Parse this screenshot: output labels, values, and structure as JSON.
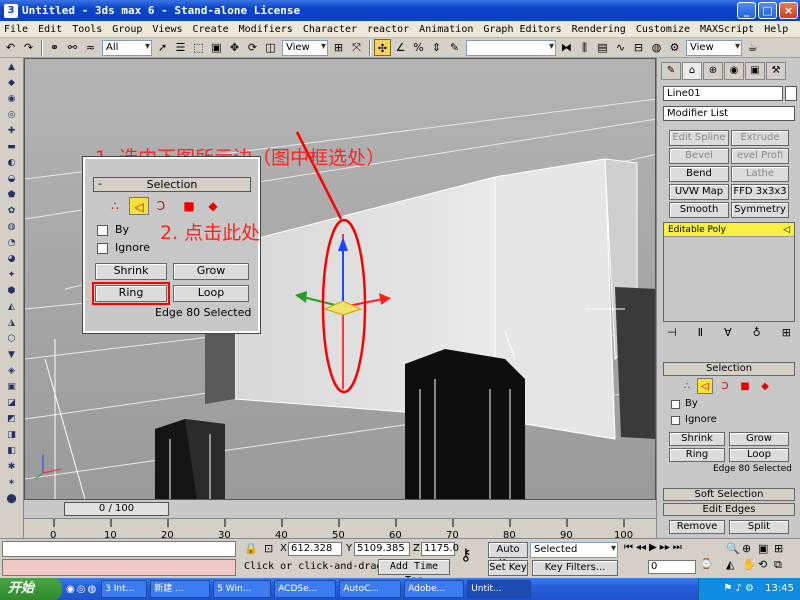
{
  "window": {
    "title": "Untitled - 3ds max 6 - Stand-alone License",
    "minimize": "_",
    "maximize": "□",
    "close": "×"
  },
  "menu": [
    "File",
    "Edit",
    "Tools",
    "Group",
    "Views",
    "Create",
    "Modifiers",
    "Character",
    "reactor",
    "Animation",
    "Graph Editors",
    "Rendering",
    "Customize",
    "MAXScript",
    "Help"
  ],
  "toolbar": {
    "filter_select": "All",
    "coord_select": "View",
    "named_selection": "",
    "view_select_right": "View"
  },
  "annotations": {
    "step1": "1. 选中下图所示边（图中框选处）",
    "step2": "2. 点击此处"
  },
  "zoomed_panel": {
    "header": "Selection",
    "by_label": "By",
    "ignore_label": "Ignore",
    "shrink": "Shrink",
    "grow": "Grow",
    "ring": "Ring",
    "loop": "Loop",
    "status": "Edge 80 Selected"
  },
  "command_panel": {
    "object_name": "Line01",
    "modifier_list": "Modifier List",
    "buttons": [
      "Edit Spline",
      "Extrude",
      "Bevel",
      "evel Profi",
      "Bend",
      "Lathe",
      "UVW Map",
      "FFD 3x3x3",
      "Smooth",
      "Symmetry"
    ],
    "stack_item": "Editable Poly",
    "selection_header": "Selection",
    "by_label": "By",
    "ignore_label": "Ignore",
    "shrink": "Shrink",
    "grow": "Grow",
    "ring": "Ring",
    "loop": "Loop",
    "status": "Edge 80 Selected",
    "soft_selection": "Soft Selection",
    "edit_edges": "Edit Edges",
    "remove": "Remove",
    "split": "Split"
  },
  "timeline": {
    "slider": "0 / 100",
    "ticks": [
      "0",
      "10",
      "20",
      "30",
      "40",
      "50",
      "60",
      "70",
      "80",
      "90",
      "100"
    ]
  },
  "status": {
    "prompt": "Click or click-and-drag",
    "add_time_tag": "Add Time Tag",
    "x_label": "X",
    "x_value": "612.328",
    "y_label": "Y",
    "y_value": "5109.385",
    "z_label": "Z",
    "z_value": "1175.0",
    "auto_key": "Auto Key",
    "set_key": "Set Key",
    "selected_option": "Selected",
    "key_filters": "Key Filters...",
    "frame": "0"
  },
  "taskbar": {
    "start": "开始",
    "tasks": [
      "3 Int...",
      "新建 ...",
      "5 Win...",
      "ACDSe...",
      "AutoC...",
      "Adobe...",
      "Untit..."
    ],
    "clock": "13:45"
  }
}
